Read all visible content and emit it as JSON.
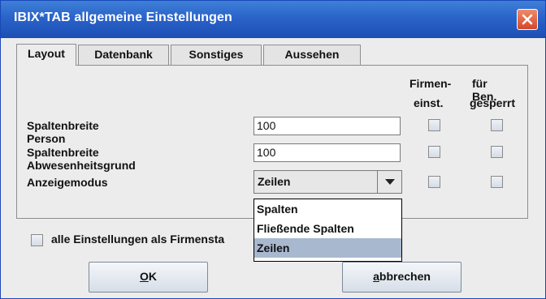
{
  "window": {
    "title": "IBIX*TAB allgemeine Einstellungen"
  },
  "tabs": [
    {
      "label": "Layout",
      "active": true
    },
    {
      "label": "Datenbank",
      "active": false
    },
    {
      "label": "Sonstiges",
      "active": false
    },
    {
      "label": "Aussehen",
      "active": false
    }
  ],
  "columns": {
    "firm_line1": "Firmen-",
    "firm_line2": "einst.",
    "user_line1": "für Ben.",
    "user_line2": "gesperrt"
  },
  "rows": [
    {
      "label": "Spaltenbreite Person",
      "value": "100"
    },
    {
      "label": "Spaltenbreite Abwesenheitsgrund",
      "value": "100"
    },
    {
      "label": "Anzeigemodus",
      "value": "Zeilen"
    }
  ],
  "dropdown": {
    "options": [
      "Spalten",
      "Fließende Spalten",
      "Zeilen"
    ],
    "selected": "Zeilen"
  },
  "global_setting": {
    "label": "alle Einstellungen als Firmensta",
    "checked": false
  },
  "buttons": {
    "ok_mnemonic": "O",
    "ok_rest": "K",
    "cancel_mnemonic": "a",
    "cancel_rest": "bbrechen"
  },
  "colors": {
    "titlebar": "#2a63c9",
    "close": "#d4472a",
    "selection": "#a8b8cf"
  }
}
